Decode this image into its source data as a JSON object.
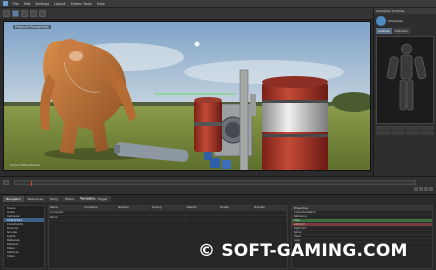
{
  "menubar": {
    "items": [
      "File",
      "Edit",
      "Settings",
      "Layout",
      "Python Tools",
      "Help"
    ]
  },
  "viewport": {
    "camera_label": "Producer Perspective",
    "footer_text": "Scene: MotionBuilder"
  },
  "character_panel": {
    "title": "Character Controls",
    "character_name": "Character",
    "tabs": [
      "Controls",
      "Definition"
    ]
  },
  "bottom_panel": {
    "tabs": [
      "Navigator",
      "Resources",
      "Story",
      "Filters",
      "Animation Trigger"
    ],
    "title": "Navigator",
    "tree_items": [
      "Scene",
      "Audio",
      "Cameras",
      "Characters",
      "Constraints",
      "Devices",
      "Groups",
      "Lights",
      "Materials",
      "Shaders",
      "Takes",
      "Textures",
      "Video"
    ],
    "selected_tree_index": 3,
    "grid_headers": [
      "Name",
      "Translation",
      "Rotation",
      "Scaling",
      "Visibility",
      "Enable",
      "Pickable"
    ],
    "grid_rows": [
      [
        "Orangutan",
        "",
        "",
        "",
        "",
        "",
        ""
      ],
      [
        "Barrel",
        "",
        "",
        "",
        "",
        "",
        ""
      ]
    ],
    "props_title": "Properties",
    "props_rows": [
      "Characterization",
      "Reference",
      "Hips",
      "Left Arm",
      "Right Arm",
      "Spine",
      "Head",
      "Legs"
    ],
    "highlight_green_index": 2,
    "highlight_red_index": 3
  },
  "watermark": {
    "text": "© SOFT-GAMING.COM"
  },
  "colors": {
    "accent": "#5b7fa6",
    "sky_top": "#8fb2d2",
    "grass": "#7a8f3e",
    "barrel_red": "#b5382c",
    "character_orange": "#c47a3a"
  }
}
